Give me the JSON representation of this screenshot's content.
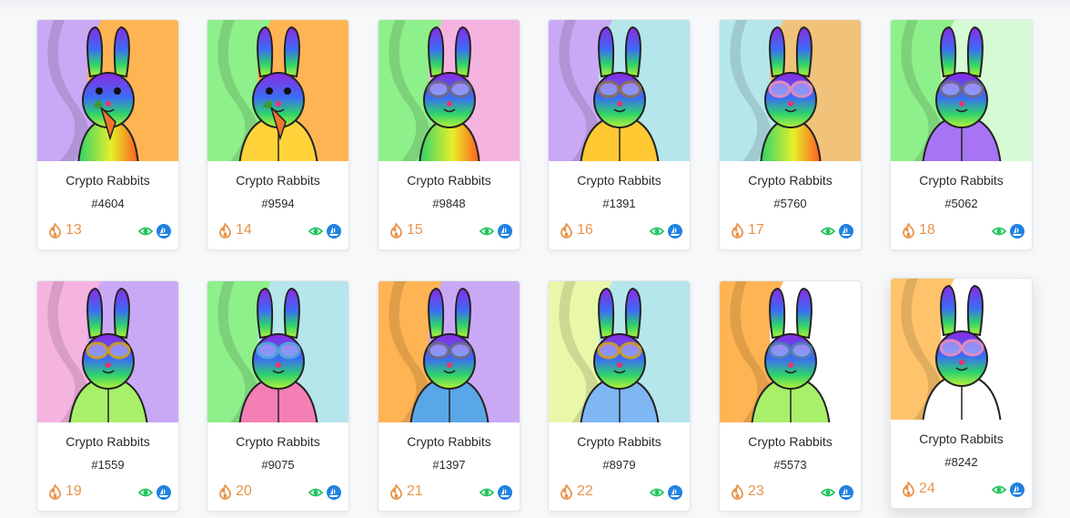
{
  "collection": "Crypto Rabbits",
  "colors": {
    "like": "#e8944a",
    "view": "#22c55e",
    "opensea": "#2081e2"
  },
  "icons": {
    "likes": "flame-icon",
    "view": "eye-icon",
    "market": "opensea-ship-icon"
  },
  "cards": [
    {
      "name": "Crypto Rabbits",
      "token": "#4604",
      "likes": "13",
      "bg1": "#c9a9f5",
      "bg2": "#ffb454",
      "shirt": "none",
      "glasses": "none",
      "carrot": true
    },
    {
      "name": "Crypto Rabbits",
      "token": "#9594",
      "likes": "14",
      "bg1": "#8ef08a",
      "bg2": "#ffb454",
      "shirt": "#ffd43b",
      "glasses": "none",
      "carrot": true
    },
    {
      "name": "Crypto Rabbits",
      "token": "#9848",
      "likes": "15",
      "bg1": "#8ef08a",
      "bg2": "#f5b3e0",
      "shirt": "none",
      "glasses": "#6b6b8f",
      "carrot": false
    },
    {
      "name": "Crypto Rabbits",
      "token": "#1391",
      "likes": "16",
      "bg1": "#c9a9f5",
      "bg2": "#b5e6ec",
      "shirt": "#ffc933",
      "glasses": "#8a7060",
      "carrot": false
    },
    {
      "name": "Crypto Rabbits",
      "token": "#5760",
      "likes": "17",
      "bg1": "#b5e6ec",
      "bg2": "#f1c27a",
      "shirt": "none",
      "glasses": "#e08abf",
      "carrot": false
    },
    {
      "name": "Crypto Rabbits",
      "token": "#5062",
      "likes": "18",
      "bg1": "#8ef08a",
      "bg2": "#d6fbd4",
      "shirt": "#a774f5",
      "glasses": "#6b6b8f",
      "carrot": false
    },
    {
      "name": "Crypto Rabbits",
      "token": "#1559",
      "likes": "19",
      "bg1": "#f5b3e0",
      "bg2": "#c9a9f5",
      "shirt": "#a8f069",
      "glasses": "#c79a2f",
      "carrot": false
    },
    {
      "name": "Crypto Rabbits",
      "token": "#9075",
      "likes": "20",
      "bg1": "#8ef08a",
      "bg2": "#b5e6ec",
      "shirt": "#f47fb4",
      "glasses": "#4fa3d9",
      "carrot": false
    },
    {
      "name": "Crypto Rabbits",
      "token": "#1397",
      "likes": "21",
      "bg1": "#ffb454",
      "bg2": "#c9a9f5",
      "shirt": "#5aa7e8",
      "glasses": "#6b6b8f",
      "carrot": false
    },
    {
      "name": "Crypto Rabbits",
      "token": "#8979",
      "likes": "22",
      "bg1": "#e9f7a8",
      "bg2": "#b5e6ec",
      "shirt": "#7fb7f2",
      "glasses": "#c79a2f",
      "carrot": false
    },
    {
      "name": "Crypto Rabbits",
      "token": "#5573",
      "likes": "23",
      "bg1": "#ffb454",
      "bg2": "#ffffff",
      "shirt": "#a8f069",
      "glasses": "#4f7fb3",
      "carrot": false
    },
    {
      "name": "Crypto Rabbits",
      "token": "#8242",
      "likes": "24",
      "bg1": "#ffc46b",
      "bg2": "#ffffff",
      "shirt": "#ffffff",
      "glasses": "#e08abf",
      "carrot": false
    }
  ]
}
